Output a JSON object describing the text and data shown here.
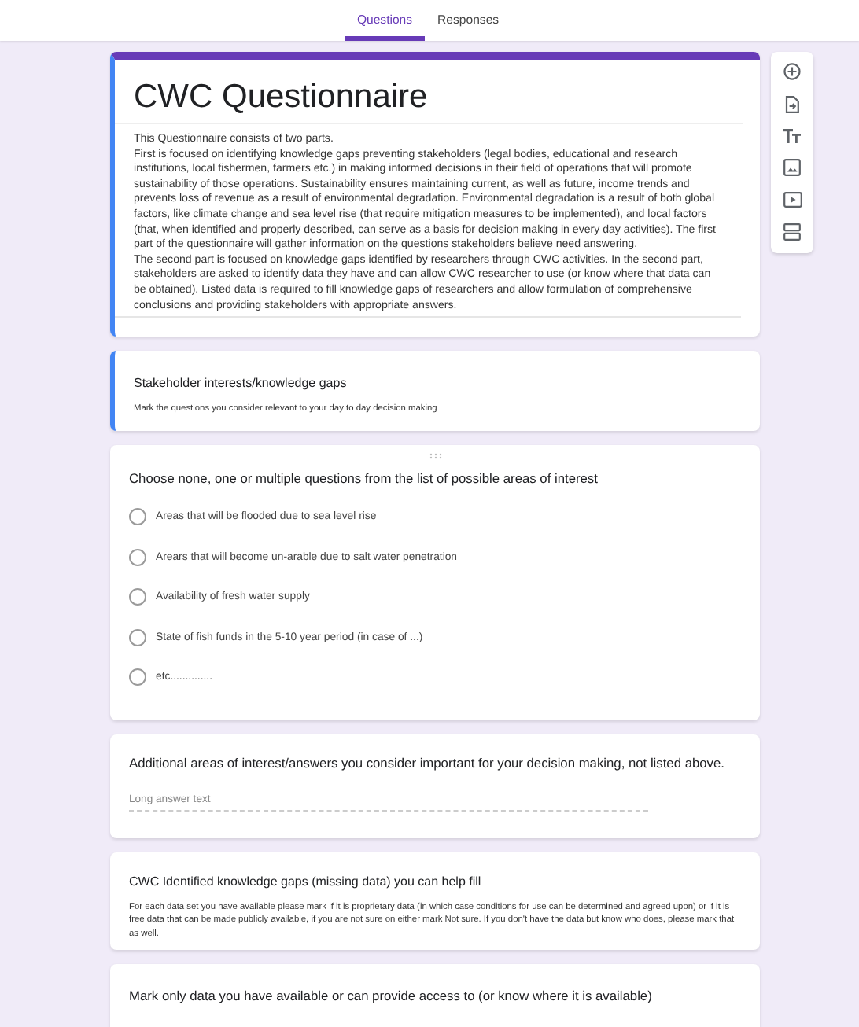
{
  "tabs": [
    {
      "label": "Questions",
      "selected": true
    },
    {
      "label": "Responses",
      "selected": false
    }
  ],
  "form": {
    "title": "CWC Questionnaire",
    "selected": true,
    "description": "This Questionnaire consists of two parts.\nFirst is focused on identifying knowledge gaps preventing stakeholders (legal bodies, educational and research institutions, local fishermen, farmers etc.) in making informed decisions in their field of operations that will promote sustainability of those operations. Sustainability ensures maintaining current, as well as future, income trends and prevents loss of revenue as a result of environmental degradation. Environmental degradation is a result of both global factors, like climate change and sea level rise (that require mitigation measures to be implemented), and local factors (that, when identified and properly described, can serve as a basis for decision making in every day activities). The first part of the questionnaire will gather information on the questions stakeholders believe need answering.\nThe second part is focused on knowledge gaps identified by researchers through CWC activities. In the second part, stakeholders are asked to identify data they have and can allow CWC researcher to use (or know where that data can be obtained). Listed data is required to fill knowledge gaps of researchers and allow formulation of comprehensive conclusions and providing stakeholders with appropriate answers."
  },
  "items": [
    {
      "kind": "section",
      "selected": true,
      "title": "Stakeholder interests/knowledge gaps",
      "description": "Mark the questions you consider relevant to your day to day decision making"
    },
    {
      "kind": "choice",
      "selected": false,
      "question": "Choose none, one or multiple questions from the list of possible areas of interest",
      "options": [
        {
          "label": "Areas that will be flooded due to sea level rise",
          "selected": false
        },
        {
          "label": "Arears that will become un-arable due to salt water penetration",
          "selected": false
        },
        {
          "label": "Availability of fresh water supply",
          "selected": false
        },
        {
          "label": "State of fish funds in the 5-10 year period (in case of ...)",
          "selected": false
        },
        {
          "label": "etc..............",
          "selected": false
        }
      ]
    },
    {
      "kind": "paragraph",
      "selected": false,
      "question": "Additional areas of interest/answers you consider important for your decision making, not listed above.",
      "placeholder": "Long answer text"
    },
    {
      "kind": "section",
      "selected": false,
      "title": "CWC Identified knowledge gaps (missing data) you can help fill",
      "description": "For each data set you have available please mark if it is proprietary data (in which case conditions for use can be determined and agreed upon) or if it is free data that can be made publicly available, if you are not sure on either mark Not sure. If you don't have the data but know who does, please mark that as well."
    },
    {
      "kind": "question",
      "selected": false,
      "question": "Mark only data you have available or can provide access to (or know where it is available)"
    }
  ]
}
